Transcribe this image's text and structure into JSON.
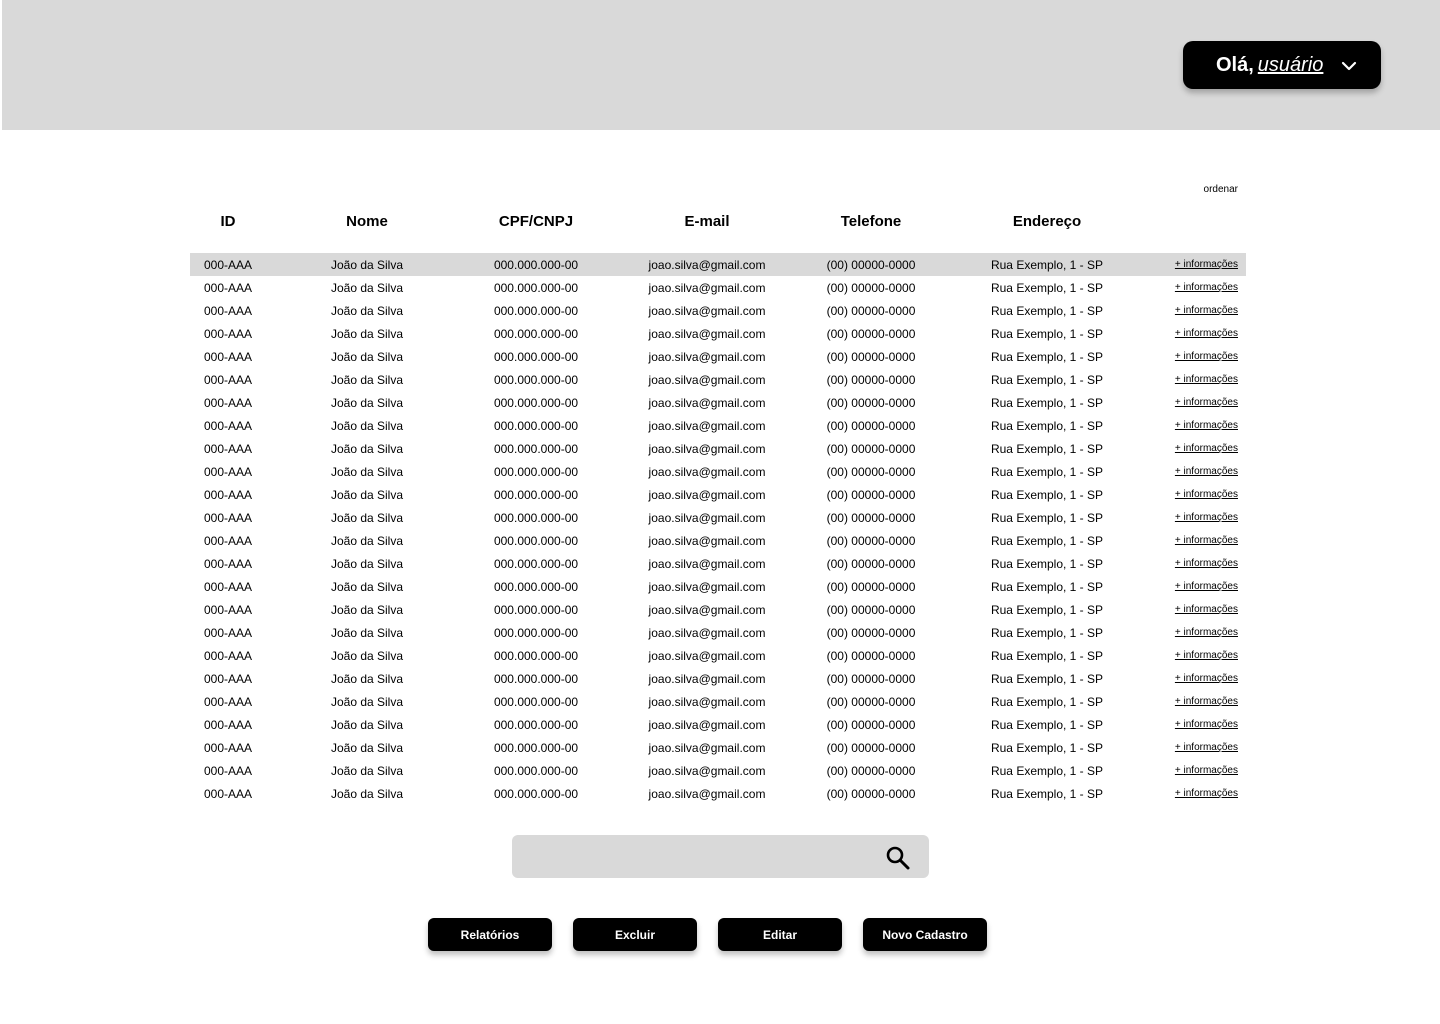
{
  "header": {
    "greeting": "Olá,",
    "username": "usuário",
    "dropdown_icon": "chevron-down-icon"
  },
  "table": {
    "sort_label": "ordenar",
    "columns": [
      "ID",
      "Nome",
      "CPF/CNPJ",
      "E-mail",
      "Telefone",
      "Endereço"
    ],
    "more_label": "+ informações",
    "selected_row": 0,
    "rows": [
      [
        "000-AAA",
        "João da Silva",
        "000.000.000-00",
        "joao.silva@gmail.com",
        "(00) 00000-0000",
        "Rua Exemplo, 1 - SP"
      ],
      [
        "000-AAA",
        "João da Silva",
        "000.000.000-00",
        "joao.silva@gmail.com",
        "(00) 00000-0000",
        "Rua Exemplo, 1 - SP"
      ],
      [
        "000-AAA",
        "João da Silva",
        "000.000.000-00",
        "joao.silva@gmail.com",
        "(00) 00000-0000",
        "Rua Exemplo, 1 - SP"
      ],
      [
        "000-AAA",
        "João da Silva",
        "000.000.000-00",
        "joao.silva@gmail.com",
        "(00) 00000-0000",
        "Rua Exemplo, 1 - SP"
      ],
      [
        "000-AAA",
        "João da Silva",
        "000.000.000-00",
        "joao.silva@gmail.com",
        "(00) 00000-0000",
        "Rua Exemplo, 1 - SP"
      ],
      [
        "000-AAA",
        "João da Silva",
        "000.000.000-00",
        "joao.silva@gmail.com",
        "(00) 00000-0000",
        "Rua Exemplo, 1 - SP"
      ],
      [
        "000-AAA",
        "João da Silva",
        "000.000.000-00",
        "joao.silva@gmail.com",
        "(00) 00000-0000",
        "Rua Exemplo, 1 - SP"
      ],
      [
        "000-AAA",
        "João da Silva",
        "000.000.000-00",
        "joao.silva@gmail.com",
        "(00) 00000-0000",
        "Rua Exemplo, 1 - SP"
      ],
      [
        "000-AAA",
        "João da Silva",
        "000.000.000-00",
        "joao.silva@gmail.com",
        "(00) 00000-0000",
        "Rua Exemplo, 1 - SP"
      ],
      [
        "000-AAA",
        "João da Silva",
        "000.000.000-00",
        "joao.silva@gmail.com",
        "(00) 00000-0000",
        "Rua Exemplo, 1 - SP"
      ],
      [
        "000-AAA",
        "João da Silva",
        "000.000.000-00",
        "joao.silva@gmail.com",
        "(00) 00000-0000",
        "Rua Exemplo, 1 - SP"
      ],
      [
        "000-AAA",
        "João da Silva",
        "000.000.000-00",
        "joao.silva@gmail.com",
        "(00) 00000-0000",
        "Rua Exemplo, 1 - SP"
      ],
      [
        "000-AAA",
        "João da Silva",
        "000.000.000-00",
        "joao.silva@gmail.com",
        "(00) 00000-0000",
        "Rua Exemplo, 1 - SP"
      ],
      [
        "000-AAA",
        "João da Silva",
        "000.000.000-00",
        "joao.silva@gmail.com",
        "(00) 00000-0000",
        "Rua Exemplo, 1 - SP"
      ],
      [
        "000-AAA",
        "João da Silva",
        "000.000.000-00",
        "joao.silva@gmail.com",
        "(00) 00000-0000",
        "Rua Exemplo, 1 - SP"
      ],
      [
        "000-AAA",
        "João da Silva",
        "000.000.000-00",
        "joao.silva@gmail.com",
        "(00) 00000-0000",
        "Rua Exemplo, 1 - SP"
      ],
      [
        "000-AAA",
        "João da Silva",
        "000.000.000-00",
        "joao.silva@gmail.com",
        "(00) 00000-0000",
        "Rua Exemplo, 1 - SP"
      ],
      [
        "000-AAA",
        "João da Silva",
        "000.000.000-00",
        "joao.silva@gmail.com",
        "(00) 00000-0000",
        "Rua Exemplo, 1 - SP"
      ],
      [
        "000-AAA",
        "João da Silva",
        "000.000.000-00",
        "joao.silva@gmail.com",
        "(00) 00000-0000",
        "Rua Exemplo, 1 - SP"
      ],
      [
        "000-AAA",
        "João da Silva",
        "000.000.000-00",
        "joao.silva@gmail.com",
        "(00) 00000-0000",
        "Rua Exemplo, 1 - SP"
      ],
      [
        "000-AAA",
        "João da Silva",
        "000.000.000-00",
        "joao.silva@gmail.com",
        "(00) 00000-0000",
        "Rua Exemplo, 1 - SP"
      ],
      [
        "000-AAA",
        "João da Silva",
        "000.000.000-00",
        "joao.silva@gmail.com",
        "(00) 00000-0000",
        "Rua Exemplo, 1 - SP"
      ],
      [
        "000-AAA",
        "João da Silva",
        "000.000.000-00",
        "joao.silva@gmail.com",
        "(00) 00000-0000",
        "Rua Exemplo, 1 - SP"
      ],
      [
        "000-AAA",
        "João da Silva",
        "000.000.000-00",
        "joao.silva@gmail.com",
        "(00) 00000-0000",
        "Rua Exemplo, 1 - SP"
      ]
    ]
  },
  "search": {
    "placeholder": "",
    "icon": "search-icon"
  },
  "actions": {
    "reports_label": "Relatórios",
    "delete_label": "Excluir",
    "edit_label": "Editar",
    "new_label": "Novo Cadastro"
  },
  "colors": {
    "header_bg": "#d9d9d9",
    "selected_row_bg": "#d9d9d9",
    "button_bg": "#000000",
    "button_text": "#ffffff"
  }
}
